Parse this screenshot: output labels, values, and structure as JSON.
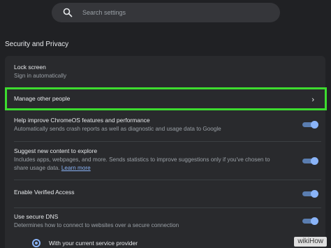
{
  "search": {
    "placeholder": "Search settings"
  },
  "section": {
    "title": "Security and Privacy"
  },
  "rows": [
    {
      "title": "Lock screen",
      "subtitle": "Sign in automatically"
    },
    {
      "title": "Manage other people"
    },
    {
      "title": "Help improve ChromeOS features and performance",
      "subtitle": "Automatically sends crash reports as well as diagnostic and usage data to Google",
      "toggle": true
    },
    {
      "title": "Suggest new content to explore",
      "subtitle_line1": "Includes apps, webpages, and more. Sends statistics to improve suggestions only if you've chosen to",
      "subtitle_line2": "share usage data.",
      "link": "Learn more",
      "toggle": true
    },
    {
      "title": "Enable Verified Access",
      "toggle": true
    },
    {
      "title": "Use secure DNS",
      "subtitle": "Determines how to connect to websites over a secure connection",
      "toggle": true
    }
  ],
  "dns_option": {
    "label": "With your current service provider",
    "selected": true
  },
  "watermark": {
    "text": "wikiHow"
  },
  "colors": {
    "highlight": "#3ddc2f",
    "accent": "#8ab4f8",
    "background": "#202124",
    "card": "#292a2d"
  }
}
